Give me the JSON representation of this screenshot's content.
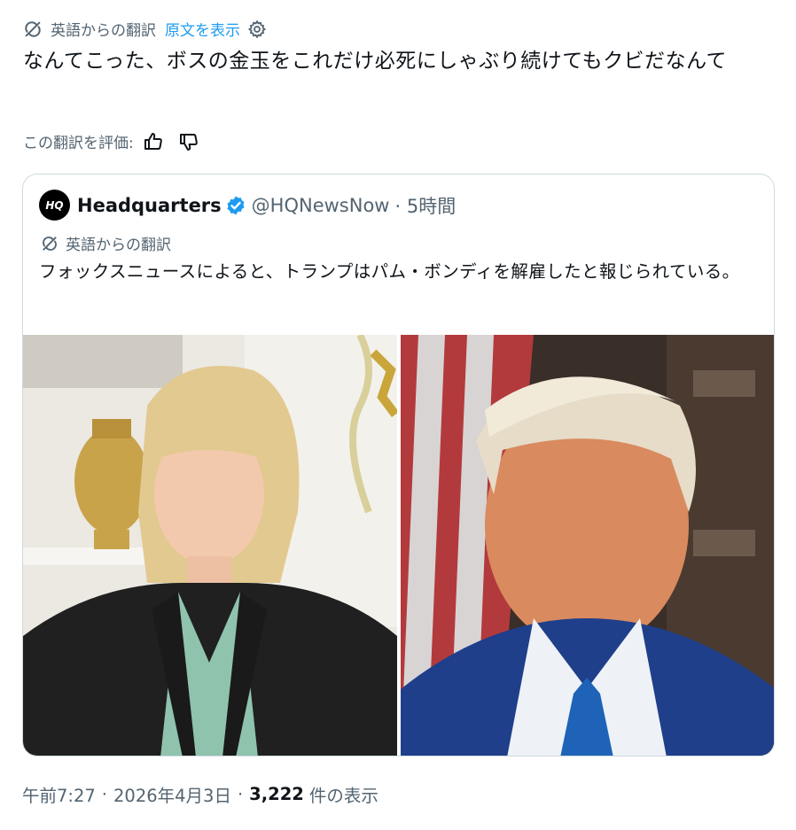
{
  "post": {
    "translated_label": "英語からの翻訳",
    "show_original": "原文を表示",
    "text": "なんてこった、ボスの金玉をこれだけ必死にしゃぶり続けてもクビだなんて",
    "rate_label": "この翻訳を評価:"
  },
  "quote": {
    "avatar_text": "HQ",
    "name": "Headquarters",
    "handle": "@HQNewsNow",
    "time": "· 5時間",
    "translated_label": "英語からの翻訳",
    "text": "フォックスニュースによると、トランプはパム・ボンディを解雇したと報じられている。"
  },
  "meta": {
    "time": "午前7:27",
    "sep1": "·",
    "date": "2026年4月3日",
    "sep2": "·",
    "views": "3,222",
    "views_label": "件の表示"
  },
  "colors": {
    "link": "#1d9bf0",
    "muted": "#536471",
    "text": "#0f1419",
    "verified": "#1d9bf0"
  },
  "icons": {
    "translate": "translate-icon",
    "gear": "gear-icon",
    "thumbs_up": "thumbs-up-icon",
    "thumbs_down": "thumbs-down-icon",
    "verified": "verified-badge-icon"
  }
}
